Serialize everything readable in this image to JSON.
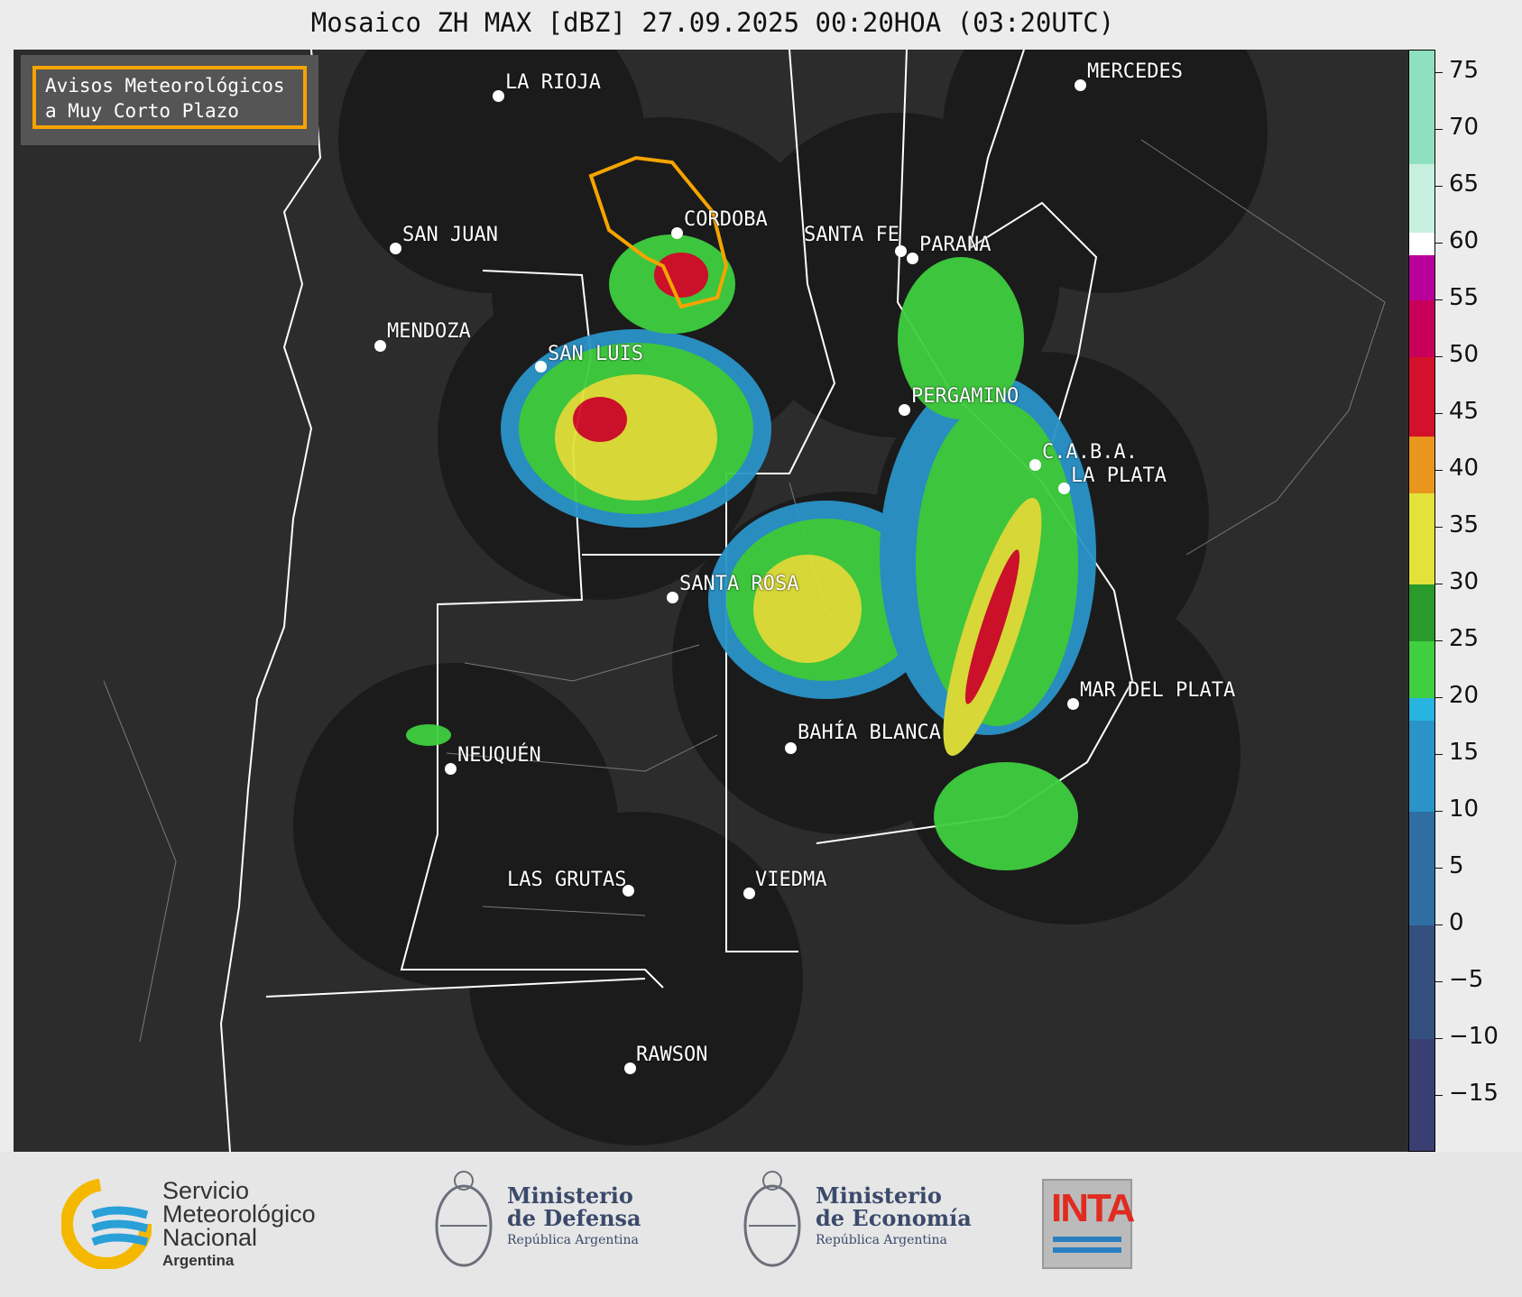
{
  "title": "Mosaico ZH MAX [dBZ] 27.09.2025 00:20HOA (03:20UTC)",
  "warning_box": {
    "line1": "Avisos Meteorológicos",
    "line2": "a Muy Corto Plazo",
    "border_color": "#f5a400"
  },
  "cities": [
    {
      "name": "LA RIOJA"
    },
    {
      "name": "MERCEDES"
    },
    {
      "name": "SAN JUAN"
    },
    {
      "name": "CORDOBA"
    },
    {
      "name": "SANTA FE"
    },
    {
      "name": "PARANA"
    },
    {
      "name": "MENDOZA"
    },
    {
      "name": "SAN LUIS"
    },
    {
      "name": "PERGAMINO"
    },
    {
      "name": "C.A.B.A."
    },
    {
      "name": "LA PLATA"
    },
    {
      "name": "SANTA ROSA"
    },
    {
      "name": "MAR DEL PLATA"
    },
    {
      "name": "BAHÍA BLANCA"
    },
    {
      "name": "NEUQUÉN"
    },
    {
      "name": "LAS GRUTAS"
    },
    {
      "name": "VIEDMA"
    },
    {
      "name": "RAWSON"
    }
  ],
  "colorbar": {
    "unit": "dBZ",
    "min": -20,
    "max": 77,
    "ticks": [
      "75",
      "70",
      "65",
      "60",
      "55",
      "50",
      "45",
      "40",
      "35",
      "30",
      "25",
      "20",
      "15",
      "10",
      "5",
      "0",
      "−5",
      "−10",
      "−15"
    ],
    "tick_values": [
      75,
      70,
      65,
      60,
      55,
      50,
      45,
      40,
      35,
      30,
      25,
      20,
      15,
      10,
      5,
      0,
      -5,
      -10,
      -15
    ],
    "colors": [
      {
        "from": -20,
        "to": -10,
        "color": "#3a3f72"
      },
      {
        "from": -10,
        "to": 0,
        "color": "#34507f"
      },
      {
        "from": 0,
        "to": 10,
        "color": "#2f6ea3"
      },
      {
        "from": 10,
        "to": 18,
        "color": "#2a94c8"
      },
      {
        "from": 18,
        "to": 20,
        "color": "#27b4e0"
      },
      {
        "from": 20,
        "to": 25,
        "color": "#3fcf3f"
      },
      {
        "from": 25,
        "to": 30,
        "color": "#2a9a2a"
      },
      {
        "from": 30,
        "to": 38,
        "color": "#e2e23a"
      },
      {
        "from": 38,
        "to": 43,
        "color": "#e8961e"
      },
      {
        "from": 43,
        "to": 50,
        "color": "#d4112a"
      },
      {
        "from": 50,
        "to": 55,
        "color": "#c8005a"
      },
      {
        "from": 55,
        "to": 59,
        "color": "#b8009a"
      },
      {
        "from": 59,
        "to": 61,
        "color": "#ffffff"
      },
      {
        "from": 61,
        "to": 67,
        "color": "#c7efe0"
      },
      {
        "from": 67,
        "to": 77,
        "color": "#8ee0c0"
      }
    ]
  },
  "footer": {
    "smn": {
      "line1": "Servicio",
      "line2": "Meteorológico",
      "line3": "Nacional",
      "line4": "Argentina"
    },
    "defensa": {
      "line1": "Ministerio",
      "line2": "de Defensa",
      "line3": "República Argentina"
    },
    "economia": {
      "line1": "Ministerio",
      "line2": "de Economía",
      "line3": "República Argentina"
    },
    "inta": {
      "label": "INTA"
    }
  }
}
